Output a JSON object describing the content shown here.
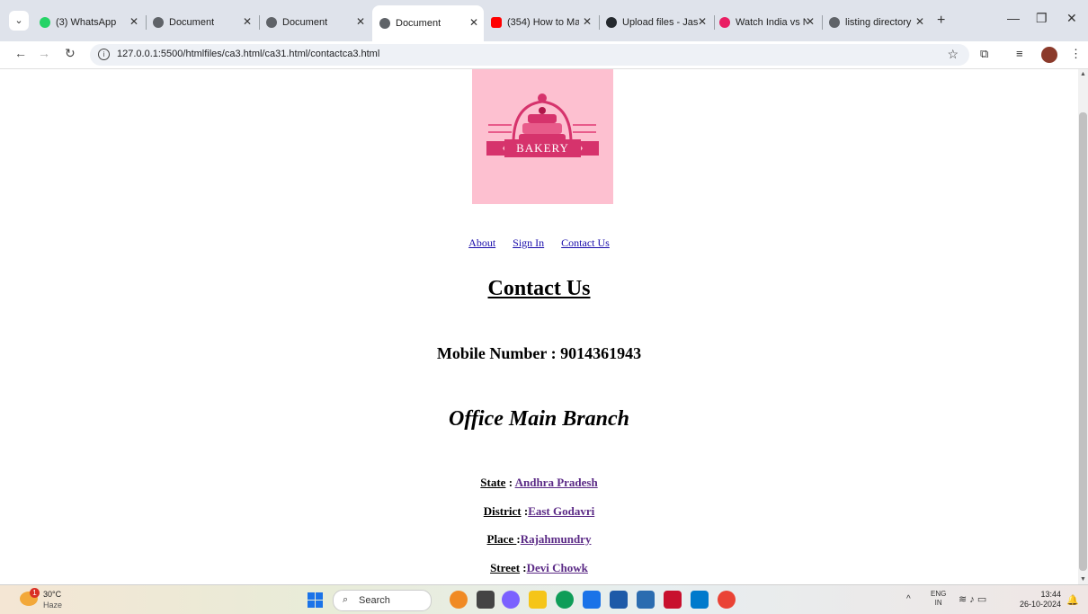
{
  "browser": {
    "tabs": [
      {
        "title": "(3) WhatsApp",
        "favicon_color": "#25d366",
        "active": false
      },
      {
        "title": "Document",
        "favicon_color": "#5f6368",
        "active": false
      },
      {
        "title": "Document",
        "favicon_color": "#5f6368",
        "active": false
      },
      {
        "title": "Document",
        "favicon_color": "#5f6368",
        "active": true
      },
      {
        "title": "(354) How to Ma",
        "favicon_color": "#ff0000",
        "active": false
      },
      {
        "title": "Upload files - Jas",
        "favicon_color": "#24292e",
        "active": false
      },
      {
        "title": "Watch India vs N",
        "favicon_color": "#e91e63",
        "active": false
      },
      {
        "title": "listing directory",
        "favicon_color": "#5f6368",
        "active": false
      }
    ],
    "url": "127.0.0.1:5500/htmlfiles/ca3.html/ca31.html/contactca3.html"
  },
  "page": {
    "logo_text": "BAKERY",
    "nav": [
      "About",
      "Sign In",
      "Contact Us"
    ],
    "heading": "Contact Us",
    "mobile_label": "Mobile Number : 9014361943",
    "office_heading": "Office Main Branch",
    "address": [
      {
        "label": "State",
        "sep": " : ",
        "value": "Andhra Pradesh"
      },
      {
        "label": "District",
        "sep": " :",
        "value": "East Godavri"
      },
      {
        "label": "Place ",
        "sep": ":",
        "value": "Rajahmundry"
      },
      {
        "label": "Street",
        "sep": " :",
        "value": "Devi Chowk"
      }
    ]
  },
  "taskbar": {
    "weather_temp": "30°C",
    "weather_desc": "Haze",
    "weather_badge": "1",
    "search_placeholder": "Search",
    "apps": [
      {
        "name": "widgets-app",
        "color": "#f08a24"
      },
      {
        "name": "file-explorer-app",
        "color": "#444444"
      },
      {
        "name": "copilot-app",
        "color": "#7b61ff"
      },
      {
        "name": "folder-app",
        "color": "#f5c518"
      },
      {
        "name": "edge-app",
        "color": "#0f9d58"
      },
      {
        "name": "store-app",
        "color": "#1a73e8"
      },
      {
        "name": "l-app",
        "color": "#1e5aa8"
      },
      {
        "name": "pen-app",
        "color": "#2b6cb0"
      },
      {
        "name": "mcafee-app",
        "color": "#c8102e"
      },
      {
        "name": "vscode-app",
        "color": "#007acc"
      },
      {
        "name": "chrome-app",
        "color": "#ea4335"
      }
    ],
    "lang_top": "ENG",
    "lang_bottom": "IN",
    "time": "13:44",
    "date": "26-10-2024"
  }
}
